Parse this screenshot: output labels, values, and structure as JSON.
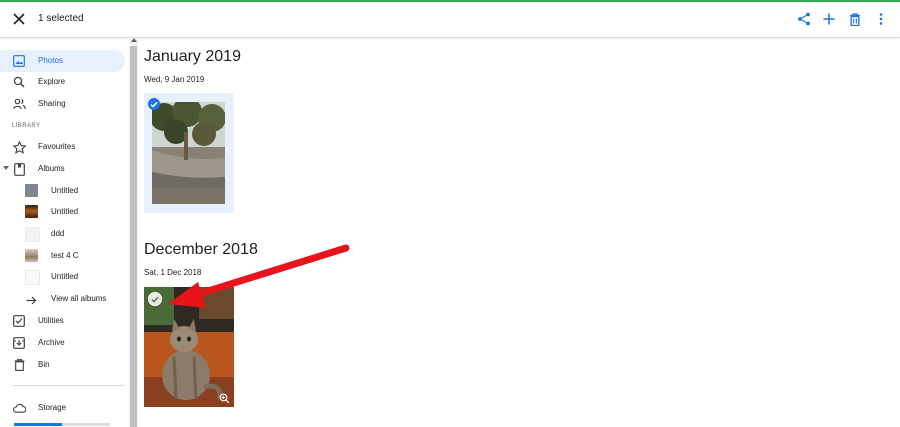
{
  "header": {
    "selection_text": "1 selected",
    "icons": [
      "close-icon",
      "share-icon",
      "add-icon",
      "delete-icon",
      "more-icon"
    ]
  },
  "sidebar": {
    "items": [
      {
        "label": "Photos",
        "icon": "photos-icon",
        "active": true
      },
      {
        "label": "Explore",
        "icon": "search-icon"
      },
      {
        "label": "Sharing",
        "icon": "people-icon"
      }
    ],
    "library_label": "LIBRARY",
    "library_items": [
      {
        "label": "Favourites",
        "icon": "star-icon"
      },
      {
        "label": "Albums",
        "icon": "album-icon"
      }
    ],
    "albums": [
      {
        "label": "Untitled"
      },
      {
        "label": "Untitled"
      },
      {
        "label": "ddd"
      },
      {
        "label": "test 4 C"
      },
      {
        "label": "Untitled"
      }
    ],
    "view_all_label": "View all albums",
    "bottom_items": [
      {
        "label": "Utilities",
        "icon": "utilities-icon"
      },
      {
        "label": "Archive",
        "icon": "archive-icon"
      },
      {
        "label": "Bin",
        "icon": "bin-icon"
      }
    ],
    "storage_label": "Storage",
    "storage_used_fraction": 0.5
  },
  "main": {
    "groups": [
      {
        "month": "January 2019",
        "day": "Wed, 9 Jan 2019",
        "selected": true
      },
      {
        "month": "December 2018",
        "day": "Sat, 1 Dec 2018",
        "selected": false
      }
    ]
  },
  "colors": {
    "accent": "#1a73e8",
    "annotation_arrow": "#e8141c",
    "selection_bg": "#e8f0fe"
  }
}
